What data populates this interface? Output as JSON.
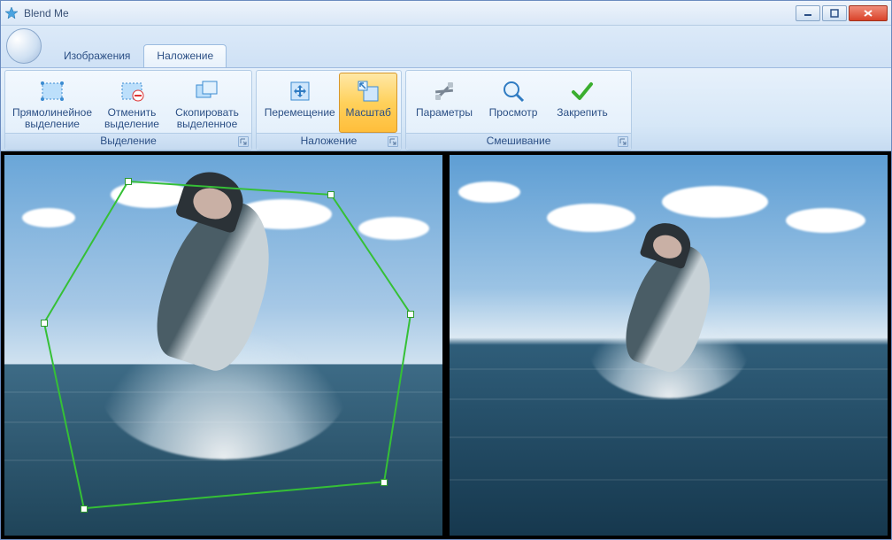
{
  "window": {
    "title": "Blend Me"
  },
  "tabs": {
    "images": "Изображения",
    "overlay": "Наложение",
    "active": "overlay"
  },
  "groups": {
    "selection": {
      "label": "Выделение",
      "rect_select": "Прямолинейное выделение",
      "cancel_select": "Отменить выделение",
      "copy_selected": "Скопировать выделенное"
    },
    "overlay": {
      "label": "Наложение",
      "move": "Перемещение",
      "scale": "Масштаб"
    },
    "blend": {
      "label": "Смешивание",
      "params": "Параметры",
      "preview": "Просмотр",
      "apply": "Закрепить"
    }
  }
}
